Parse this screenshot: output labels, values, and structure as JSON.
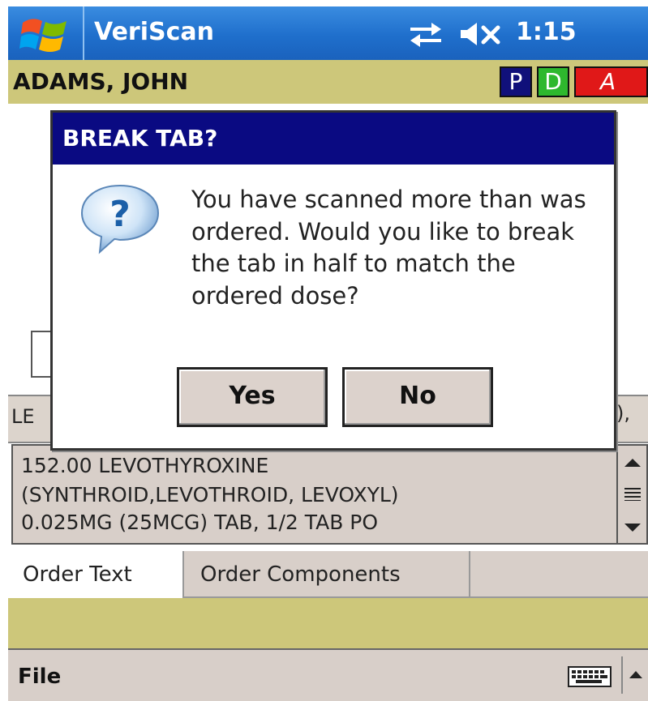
{
  "titlebar": {
    "app_title": "VeriScan",
    "clock": "1:15"
  },
  "patient": {
    "name": "ADAMS, JOHN",
    "badges": [
      "P",
      "D",
      "A"
    ]
  },
  "background": {
    "strip_left": "LE",
    "strip_right": "),"
  },
  "order_text": {
    "lines": [
      "152.00 LEVOTHYROXINE",
      "(SYNTHROID,LEVOTHROID, LEVOXYL)",
      "0.025MG (25MCG) TAB, 1/2 TAB PO"
    ]
  },
  "tabs": [
    {
      "label": "Order Text",
      "active": true
    },
    {
      "label": "Order Components",
      "active": false
    }
  ],
  "menu": {
    "file_label": "File"
  },
  "dialog": {
    "title": "BREAK TAB?",
    "message": "You have scanned more than was ordered. Would you like to break the tab in half to match the ordered dose?",
    "yes_label": "Yes",
    "no_label": "No"
  },
  "icons": {
    "start": "windows-logo-icon",
    "connectivity": "connectivity-icon",
    "volume": "volume-muted-icon",
    "question": "question-bubble-icon",
    "keyboard": "keyboard-icon"
  },
  "colors": {
    "titlebar": "#1f6fcc",
    "patient_band": "#cdc77a",
    "dialog_title": "#0a0a82",
    "badge_p": "#10107a",
    "badge_d": "#2eb82e",
    "badge_a": "#e01818"
  }
}
